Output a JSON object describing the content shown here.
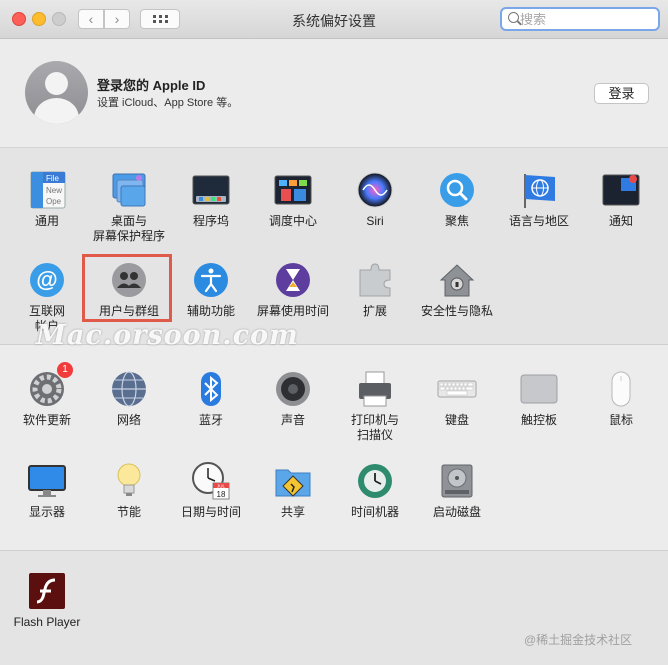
{
  "window": {
    "title": "系统偏好设置"
  },
  "search": {
    "placeholder": "搜索"
  },
  "account": {
    "title": "登录您的 Apple ID",
    "subtitle": "设置 iCloud、App Store 等。",
    "login_label": "登录"
  },
  "prefs": {
    "general": "通用",
    "desktop": "桌面与\n屏幕保护程序",
    "dock": "程序坞",
    "mission_control": "调度中心",
    "siri": "Siri",
    "spotlight": "聚焦",
    "language": "语言与地区",
    "notifications": "通知",
    "internet_accounts": "互联网\n帐户",
    "users_groups": "用户与群组",
    "accessibility": "辅助功能",
    "screen_time": "屏幕使用时间",
    "extensions": "扩展",
    "security": "安全性与隐私",
    "software_update": "软件更新",
    "software_update_badge": "1",
    "network": "网络",
    "bluetooth": "蓝牙",
    "sound": "声音",
    "printers": "打印机与\n扫描仪",
    "keyboard": "键盘",
    "trackpad": "触控板",
    "mouse": "鼠标",
    "displays": "显示器",
    "energy": "节能",
    "datetime": "日期与时间",
    "sharing": "共享",
    "time_machine": "时间机器",
    "startup_disk": "启动磁盘",
    "flash": "Flash Player",
    "general_icon_text1": "File",
    "general_icon_text2": "New",
    "general_icon_text3": "Ope",
    "calendar_month": "JUL",
    "calendar_day": "18"
  },
  "watermark": "Mac.orsoon.com",
  "corner_watermark": "@稀土掘金技术社区",
  "colors": {
    "highlight": "#e05a4a",
    "badge": "#f23b3b",
    "search_focus": "#7aa7e9"
  }
}
